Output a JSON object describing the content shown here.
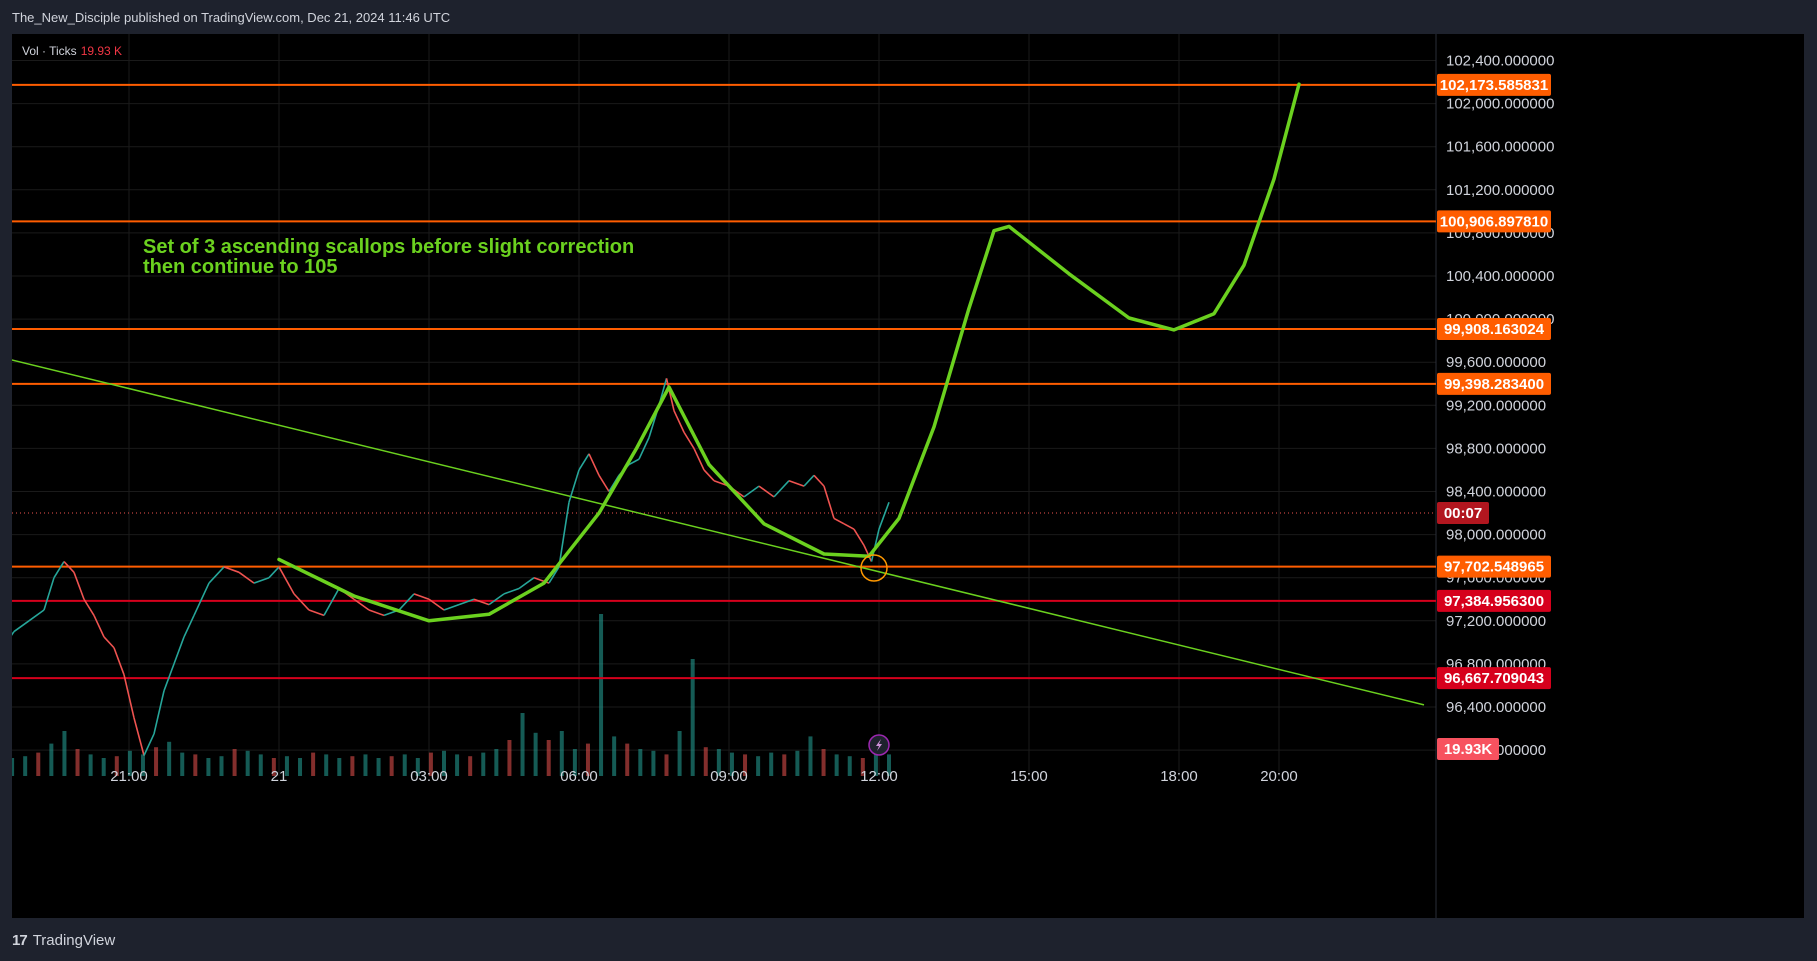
{
  "header": {
    "text": "The_New_Disciple published on TradingView.com, Dec 21, 2024 11:46 UTC"
  },
  "volume_legend": {
    "label": "Vol · Ticks",
    "value": "19.93 K"
  },
  "footer": {
    "brand": "TradingView",
    "logo": "17"
  },
  "colors": {
    "background": "#000000",
    "panel": "#1e222d",
    "orange_line": "#ff5d00",
    "red_line": "#d6001c",
    "green_drawing": "#6bd11f",
    "candle_up": "#26a69a",
    "candle_down": "#ef5350",
    "grid": "#1a1a1a"
  },
  "chart_data": {
    "type": "line",
    "symbol_note": "price chart with projection drawing",
    "ylim": [
      95900,
      102500
    ],
    "y_ticks": [
      {
        "value": 102400,
        "label": "102,400.000000"
      },
      {
        "value": 102000,
        "label": "102,000.000000"
      },
      {
        "value": 101600,
        "label": "101,600.000000"
      },
      {
        "value": 101200,
        "label": "101,200.000000"
      },
      {
        "value": 100800,
        "label": "100,800.000000"
      },
      {
        "value": 100400,
        "label": "100,400.000000"
      },
      {
        "value": 100000,
        "label": "100,000.000000"
      },
      {
        "value": 99600,
        "label": "99,600.000000"
      },
      {
        "value": 99200,
        "label": "99,200.000000"
      },
      {
        "value": 98800,
        "label": "98,800.000000"
      },
      {
        "value": 98400,
        "label": "98,400.000000"
      },
      {
        "value": 98000,
        "label": "98,000.000000"
      },
      {
        "value": 97600,
        "label": "97,600.000000"
      },
      {
        "value": 97200,
        "label": "97,200.000000"
      },
      {
        "value": 96800,
        "label": "96,800.000000"
      },
      {
        "value": 96400,
        "label": "96,400.000000"
      },
      {
        "value": 96000,
        "label": "96,000.000000"
      }
    ],
    "x_ticks": [
      "21:00",
      "21",
      "03:00",
      "06:00",
      "09:00",
      "12:00",
      "15:00",
      "18:00",
      "20:00"
    ],
    "x_tick_hours": [
      -3,
      0,
      3,
      6,
      9,
      12,
      15,
      18,
      20
    ],
    "xlim_hours": [
      -5.6,
      22.9
    ],
    "horizontal_levels": [
      {
        "value": 102173.585831,
        "label": "102,173.585831",
        "color": "orange"
      },
      {
        "value": 100906.89781,
        "label": "100,906.897810",
        "color": "orange"
      },
      {
        "value": 99908.163024,
        "label": "99,908.163024",
        "color": "orange"
      },
      {
        "value": 99398.2834,
        "label": "99,398.283400",
        "color": "orange"
      },
      {
        "value": 97702.548965,
        "label": "97,702.548965",
        "color": "orange"
      },
      {
        "value": 97384.9563,
        "label": "97,384.956300",
        "color": "red"
      },
      {
        "value": 96667.709043,
        "label": "96,667.709043",
        "color": "red"
      }
    ],
    "current_price": {
      "value": 98200,
      "countdown": "00:07"
    },
    "volume_tag": "19.93K",
    "trendline": {
      "points": [
        [
          -5.6,
          99650
        ],
        [
          22.9,
          96420
        ]
      ]
    },
    "price_series": [
      [
        -5.6,
        96900
      ],
      [
        -5.3,
        97100
      ],
      [
        -5.0,
        97200
      ],
      [
        -4.7,
        97300
      ],
      [
        -4.5,
        97600
      ],
      [
        -4.3,
        97750
      ],
      [
        -4.1,
        97650
      ],
      [
        -3.9,
        97400
      ],
      [
        -3.7,
        97250
      ],
      [
        -3.5,
        97050
      ],
      [
        -3.3,
        96950
      ],
      [
        -3.1,
        96700
      ],
      [
        -2.9,
        96300
      ],
      [
        -2.7,
        95950
      ],
      [
        -2.5,
        96150
      ],
      [
        -2.3,
        96550
      ],
      [
        -2.1,
        96800
      ],
      [
        -1.9,
        97050
      ],
      [
        -1.7,
        97250
      ],
      [
        -1.4,
        97550
      ],
      [
        -1.1,
        97700
      ],
      [
        -0.8,
        97650
      ],
      [
        -0.5,
        97550
      ],
      [
        -0.2,
        97600
      ],
      [
        0.0,
        97700
      ],
      [
        0.3,
        97450
      ],
      [
        0.6,
        97300
      ],
      [
        0.9,
        97250
      ],
      [
        1.2,
        97500
      ],
      [
        1.5,
        97400
      ],
      [
        1.8,
        97300
      ],
      [
        2.1,
        97250
      ],
      [
        2.4,
        97300
      ],
      [
        2.7,
        97450
      ],
      [
        3.0,
        97400
      ],
      [
        3.3,
        97300
      ],
      [
        3.6,
        97350
      ],
      [
        3.9,
        97400
      ],
      [
        4.2,
        97350
      ],
      [
        4.5,
        97450
      ],
      [
        4.8,
        97500
      ],
      [
        5.1,
        97600
      ],
      [
        5.4,
        97550
      ],
      [
        5.6,
        97700
      ],
      [
        5.8,
        98300
      ],
      [
        6.0,
        98600
      ],
      [
        6.2,
        98750
      ],
      [
        6.4,
        98550
      ],
      [
        6.6,
        98400
      ],
      [
        6.8,
        98550
      ],
      [
        7.0,
        98650
      ],
      [
        7.2,
        98700
      ],
      [
        7.4,
        98900
      ],
      [
        7.6,
        99200
      ],
      [
        7.75,
        99450
      ],
      [
        7.9,
        99150
      ],
      [
        8.1,
        98950
      ],
      [
        8.3,
        98800
      ],
      [
        8.5,
        98600
      ],
      [
        8.7,
        98500
      ],
      [
        9.0,
        98450
      ],
      [
        9.3,
        98350
      ],
      [
        9.6,
        98450
      ],
      [
        9.9,
        98350
      ],
      [
        10.2,
        98500
      ],
      [
        10.5,
        98450
      ],
      [
        10.7,
        98550
      ],
      [
        10.9,
        98450
      ],
      [
        11.1,
        98150
      ],
      [
        11.3,
        98100
      ],
      [
        11.5,
        98050
      ],
      [
        11.7,
        97900
      ],
      [
        11.85,
        97750
      ],
      [
        12.0,
        98050
      ],
      [
        12.2,
        98300
      ]
    ],
    "volume_series": [
      1.2,
      1.0,
      1.1,
      1.3,
      1.8,
      2.5,
      1.5,
      1.2,
      1.0,
      1.1,
      1.4,
      1.2,
      1.6,
      1.9,
      1.3,
      1.2,
      1.0,
      1.1,
      1.5,
      1.4,
      1.2,
      1.0,
      1.1,
      1.0,
      1.3,
      1.2,
      1.0,
      1.1,
      1.2,
      1.0,
      1.1,
      1.2,
      1.0,
      1.3,
      1.4,
      1.2,
      1.1,
      1.3,
      1.5,
      2.0,
      3.5,
      2.4,
      2.0,
      2.5,
      1.5,
      1.8,
      9.0,
      2.2,
      1.8,
      1.5,
      1.4,
      1.2,
      2.5,
      6.5,
      1.6,
      1.5,
      1.3,
      1.2,
      1.1,
      1.3,
      1.2,
      1.4,
      2.2,
      1.5,
      1.2,
      1.1,
      1.0,
      1.8,
      1.2
    ],
    "projection_path": [
      [
        0.0,
        97770
      ],
      [
        1.5,
        97430
      ],
      [
        3.0,
        97200
      ],
      [
        4.2,
        97260
      ],
      [
        5.3,
        97550
      ],
      [
        6.4,
        98200
      ],
      [
        7.15,
        98800
      ],
      [
        7.8,
        99370
      ],
      [
        8.6,
        98650
      ],
      [
        9.7,
        98100
      ],
      [
        10.9,
        97820
      ],
      [
        11.8,
        97800
      ],
      [
        12.4,
        98150
      ],
      [
        13.1,
        99000
      ],
      [
        13.8,
        100100
      ],
      [
        14.3,
        100820
      ],
      [
        14.6,
        100860
      ],
      [
        15.8,
        100420
      ],
      [
        17.0,
        100010
      ],
      [
        17.9,
        99900
      ],
      [
        18.7,
        100050
      ],
      [
        19.3,
        100500
      ],
      [
        19.9,
        101300
      ],
      [
        20.4,
        102180
      ]
    ],
    "highlight_circle": {
      "x": 11.9,
      "y": 97690
    },
    "annotation": {
      "lines": [
        "Set of 3 ascending scallops before slight correction",
        "then continue to 105"
      ],
      "position": "upper-left"
    }
  }
}
